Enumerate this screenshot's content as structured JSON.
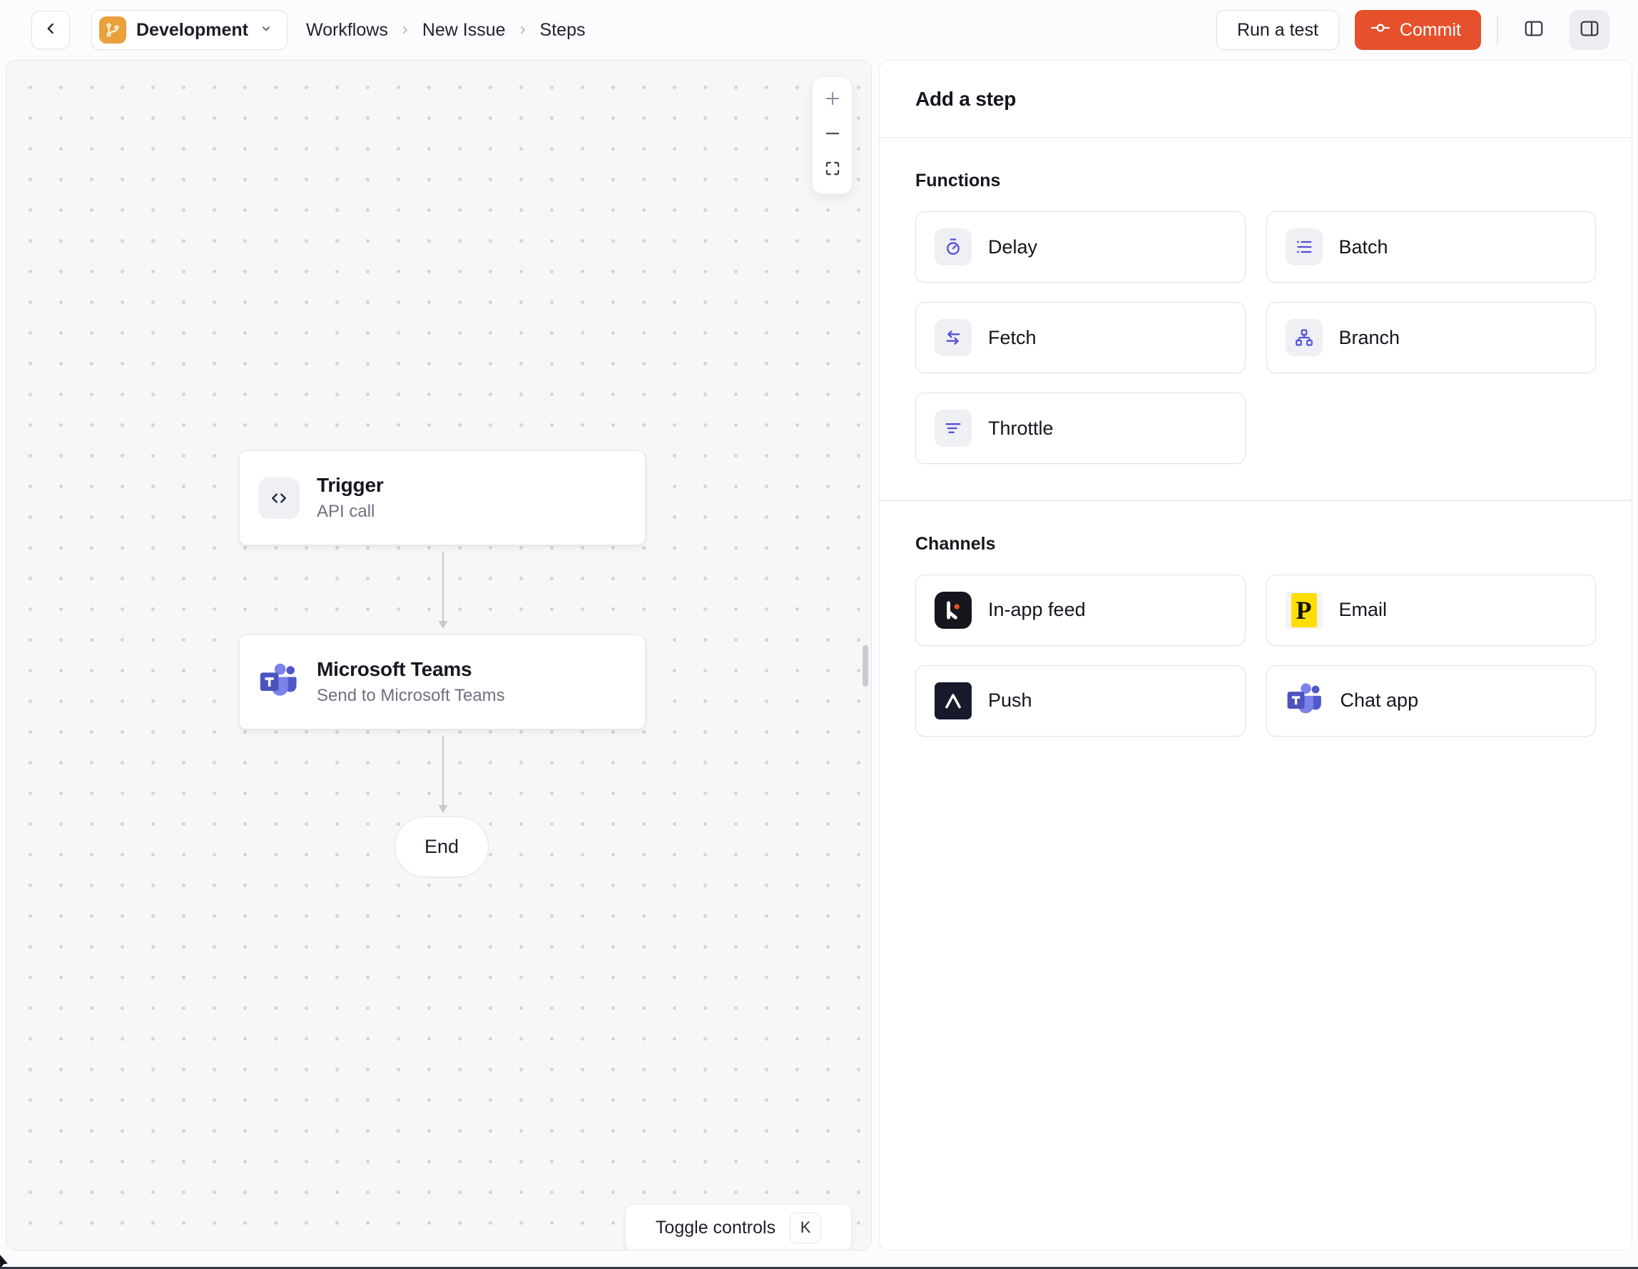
{
  "header": {
    "environment_label": "Development",
    "environment_icon": "git-branch-icon",
    "breadcrumbs": [
      "Workflows",
      "New Issue",
      "Steps"
    ],
    "run_test_label": "Run a test",
    "commit_label": "Commit",
    "commit_icon": "git-commit-icon"
  },
  "canvas": {
    "trigger": {
      "title": "Trigger",
      "subtitle": "API call",
      "icon": "code-icon"
    },
    "teams": {
      "title": "Microsoft Teams",
      "subtitle": "Send to Microsoft Teams",
      "icon": "ms-teams-icon"
    },
    "end_label": "End",
    "controls": {
      "zoom_in_icon": "plus-icon",
      "zoom_out_icon": "minus-icon",
      "fit_view_icon": "expand-icon"
    },
    "toggle_controls_label": "Toggle controls",
    "toggle_controls_shortcut": "K"
  },
  "panel": {
    "title": "Add a step",
    "functions": {
      "label": "Functions",
      "items": [
        {
          "label": "Delay",
          "icon": "stopwatch-icon"
        },
        {
          "label": "Batch",
          "icon": "list-icon"
        },
        {
          "label": "Fetch",
          "icon": "arrows-swap-icon"
        },
        {
          "label": "Branch",
          "icon": "sitemap-icon"
        },
        {
          "label": "Throttle",
          "icon": "filter-icon"
        }
      ]
    },
    "channels": {
      "label": "Channels",
      "items": [
        {
          "label": "In-app feed",
          "icon": "knock-icon"
        },
        {
          "label": "Email",
          "icon": "postmark-icon"
        },
        {
          "label": "Push",
          "icon": "expo-icon"
        },
        {
          "label": "Chat app",
          "icon": "ms-teams-icon"
        }
      ]
    }
  },
  "colors": {
    "commit_button": "#E6502C",
    "environment_icon_bg": "#E9A13B",
    "function_icon_accent": "#5450D9",
    "knock_black": "#16161E",
    "knock_dot": "#E8502B",
    "postmark_yellow": "#FFDE00",
    "expo_dark": "#161A2B",
    "teams_square": "#4B53BC",
    "teams_person": "#7B83EB",
    "teams_person_alt": "#5059C9",
    "canvas_bg": "#F7F7F8"
  }
}
